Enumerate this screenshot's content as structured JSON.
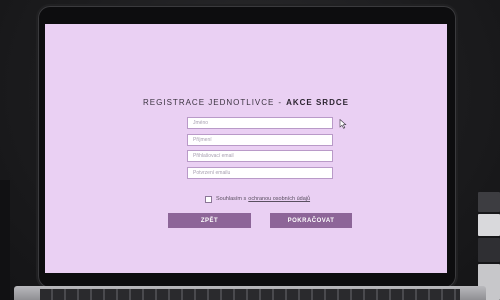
{
  "registration": {
    "title_main": "REGISTRACE JEDNOTLIVCE",
    "title_separator": "-",
    "title_event": "AKCE SRDCE",
    "fields": [
      {
        "placeholder": "Jméno"
      },
      {
        "placeholder": "Příjmení"
      },
      {
        "placeholder": "Přihlašovací email"
      },
      {
        "placeholder": "Potvrzení emailu"
      }
    ],
    "consent": {
      "text": "Souhlasím s",
      "link_text": "ochranou osobních údajů",
      "checked": false
    },
    "back_button": "ZPĚT",
    "continue_button": "POKRAČOVAT"
  },
  "colors": {
    "screen_background": "#ead0f3",
    "button": "#8d6598",
    "field_border": "#b99ac8"
  },
  "icons": [
    "mouse-cursor-icon"
  ]
}
